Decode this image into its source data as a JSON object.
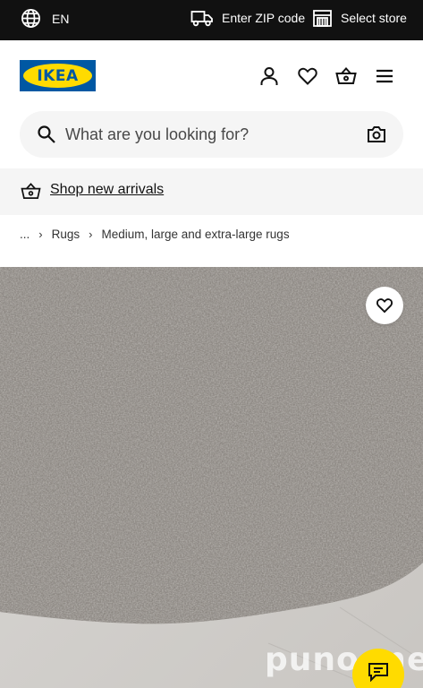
{
  "topbar": {
    "language": "EN",
    "zip_label": "Enter ZIP code",
    "store_label": "Select store"
  },
  "header": {
    "logo_text": "IKEA",
    "icons": [
      "user-icon",
      "heart-icon",
      "basket-icon",
      "menu-icon"
    ]
  },
  "search": {
    "placeholder": "What are you looking for?"
  },
  "banner": {
    "link_label": "Shop new arrivals"
  },
  "breadcrumb": {
    "items": [
      "...",
      "Rugs",
      "Medium, large and extra-large rugs"
    ]
  },
  "product": {
    "image_alt": "grey high pile rug"
  },
  "watermark": "puno.me",
  "colors": {
    "topbar_bg": "#111111",
    "brand_blue": "#0058a3",
    "brand_yellow": "#ffdb00",
    "search_bg": "#f5f5f5"
  }
}
